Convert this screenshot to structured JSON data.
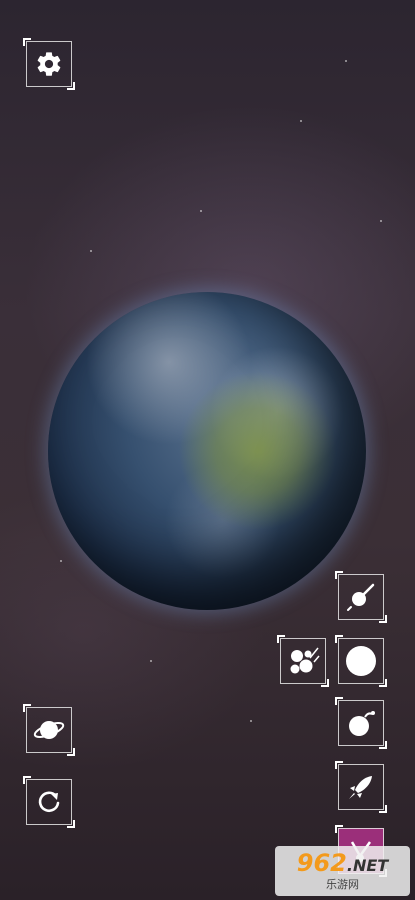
{
  "buttons": {
    "settings": {
      "icon": "gear-icon"
    },
    "planet_info": {
      "icon": "ringed-planet-icon"
    },
    "reset_rotation": {
      "icon": "rotate-icon"
    },
    "comet": {
      "icon": "comet-icon"
    },
    "asteroids": {
      "icon": "asteroid-cluster-icon"
    },
    "sphere": {
      "icon": "sphere-icon"
    },
    "bomb": {
      "icon": "bomb-icon"
    },
    "rocket": {
      "icon": "rocket-icon"
    },
    "laser": {
      "icon": "laser-icon",
      "active_color": "#9b2f7a"
    }
  },
  "watermark": {
    "main": "962",
    "suffix": ".NET",
    "sub": "乐游网"
  }
}
